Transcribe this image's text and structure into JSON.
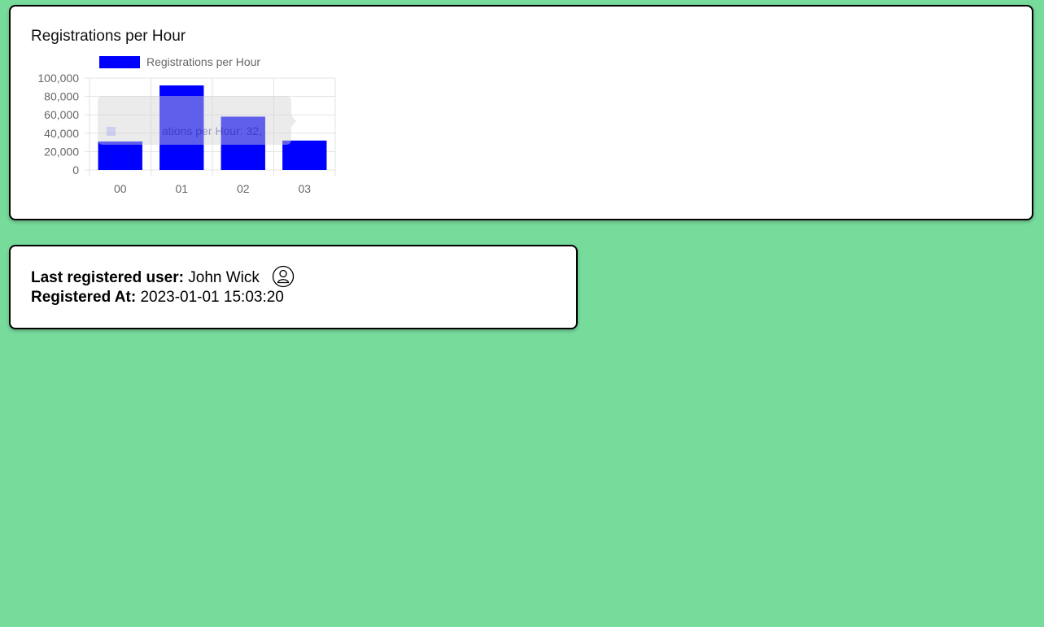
{
  "chart_card": {
    "title": "Registrations per Hour"
  },
  "chart_data": {
    "type": "bar",
    "title": "Registrations per Hour",
    "categories": [
      "00",
      "01",
      "02",
      "03"
    ],
    "series": [
      {
        "name": "Registrations per Hour",
        "values": [
          31000,
          92000,
          58000,
          32000
        ],
        "color": "#0000ff"
      }
    ],
    "ylim": [
      0,
      100000
    ],
    "yticks": [
      "100,000",
      "80,000",
      "60,000",
      "40,000",
      "20,000",
      "0"
    ],
    "ytick_values": [
      100000,
      80000,
      60000,
      40000,
      20000,
      0
    ],
    "grid": true,
    "legend_position": "top",
    "tooltip": {
      "text": "Registrations per Hour: 32,",
      "visible_fragment": "ations per Hour: 32,"
    }
  },
  "user_card": {
    "last_user_label": "Last registered user:",
    "last_user_value": "John Wick",
    "registered_at_label": "Registered At:",
    "registered_at_value": "2023-01-01 15:03:20",
    "avatar_icon": "user-circle-icon"
  },
  "colors": {
    "page_background": "#77db9c",
    "bar": "#0000ff",
    "card_border": "#000000"
  }
}
